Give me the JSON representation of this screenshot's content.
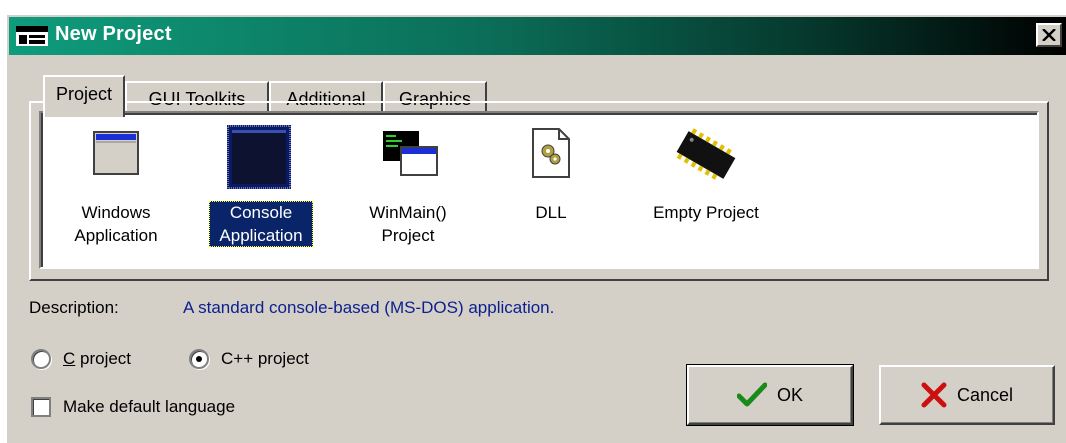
{
  "window": {
    "title": "New Project",
    "close_glyph": "✕"
  },
  "tabs": [
    {
      "label": "Project",
      "active": true
    },
    {
      "label": "GUI Toolkits",
      "active": false
    },
    {
      "label": "Additional",
      "active": false
    },
    {
      "label": "Graphics",
      "active": false
    }
  ],
  "project_types": [
    {
      "label": "Windows\nApplication",
      "icon": "window-icon",
      "selected": false
    },
    {
      "label": "Console\nApplication",
      "icon": "console-icon",
      "selected": true
    },
    {
      "label": "WinMain()\nProject",
      "icon": "winmain-icon",
      "selected": false
    },
    {
      "label": "DLL",
      "icon": "dll-gear-icon",
      "selected": false
    },
    {
      "label": "Empty Project",
      "icon": "chip-icon",
      "selected": false
    }
  ],
  "description": {
    "label": "Description:",
    "text": "A standard console-based (MS-DOS) application."
  },
  "language": {
    "c_label": "C project",
    "cpp_label": "C++ project",
    "selected": "cpp"
  },
  "default_language": {
    "label": "Make default language",
    "checked": false
  },
  "buttons": {
    "ok": "OK",
    "cancel": "Cancel"
  },
  "colors": {
    "title_start": "#0f9c7c",
    "title_end": "#000000",
    "description_text": "#0b1f8f",
    "selection": "#0a246a",
    "dialog_face": "#d4d0c8"
  }
}
